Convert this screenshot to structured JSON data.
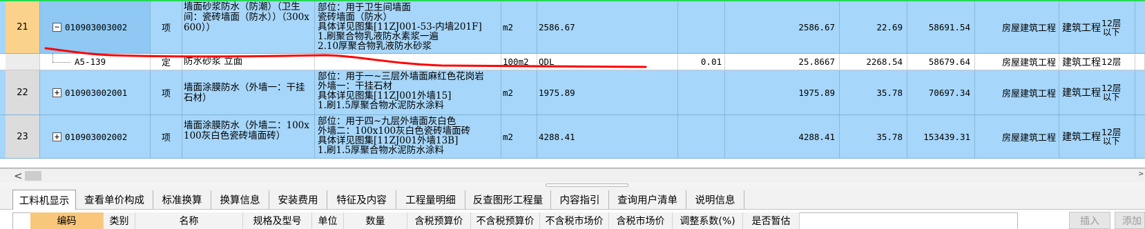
{
  "grid": {
    "rows": [
      {
        "index": "21",
        "code": "010903003002",
        "expander": "−",
        "type": "项",
        "name": "墙面砂浆防水（防潮）（卫生间：瓷砖墙面（防水））（300x600））",
        "description": "部位：用于卫生间墙面\n瓷砖墙面（防水）\n具体详见图集[11ZJ001-53-内墙201F]\n1.刷聚合物乳液防水素浆一遍\n2.10厚聚合物乳液防水砂浆",
        "unit": "m2",
        "expression": "2586.67",
        "content": "",
        "quantity": "2586.67",
        "unit_price": "22.69",
        "total": "58691.54",
        "professional": "房屋建筑工程",
        "spec_main": "建筑工程",
        "spec_small": "12层\n以下"
      },
      {
        "index": "",
        "code": "A5-139",
        "type": "定",
        "name": "防水砂浆 立面",
        "description": "",
        "unit": "100m2",
        "expression": "QDL",
        "content": "0.01",
        "quantity": "25.8667",
        "unit_price": "2268.54",
        "total": "58679.64",
        "professional": "房屋建筑工程",
        "spec_main": "建筑工程",
        "spec_small": "12层"
      },
      {
        "index": "22",
        "code": "010903002001",
        "expander": "+",
        "type": "项",
        "name": "墙面涂膜防水（外墙一：干挂石材）",
        "description": "部位：用于一~三层外墙面麻红色花岗岩\n外墙一：干挂石材\n具体详见图集[11ZJ001外墙15]\n1.刷1.5厚聚合物水泥防水涂料",
        "unit": "m2",
        "expression": "1975.89",
        "content": "",
        "quantity": "1975.89",
        "unit_price": "35.78",
        "total": "70697.34",
        "professional": "房屋建筑工程",
        "spec_main": "建筑工程",
        "spec_small": "12层\n以下"
      },
      {
        "index": "23",
        "code": "010903002002",
        "expander": "+",
        "type": "项",
        "name": "墙面涂膜防水（外墙二：100x100灰白色瓷砖墙面砖）",
        "description": "部位：用于四~九层外墙面灰白色\n外墙二：100x100灰白色瓷砖墙面砖\n具体详见图集[11ZJ001外墙13B]\n1.刷1.5厚聚合物水泥防水涂料",
        "unit": "m2",
        "expression": "4288.41",
        "content": "",
        "quantity": "4288.41",
        "unit_price": "35.78",
        "total": "153439.31",
        "professional": "房屋建筑工程",
        "spec_main": "建筑工程",
        "spec_small": "12层\n以下"
      }
    ]
  },
  "scrollbar": {
    "left_arrow": "<",
    "right_arrow": ">"
  },
  "tabs": [
    "工料机显示",
    "查看单价构成",
    "标准换算",
    "换算信息",
    "安装费用",
    "特征及内容",
    "工程量明细",
    "反查图形工程量",
    "内容指引",
    "查询用户清单",
    "说明信息"
  ],
  "lower_headers": [
    "编码",
    "类别",
    "名称",
    "规格及型号",
    "单位",
    "数量",
    "含税预算价",
    "不含税预算价",
    "不含税市场价",
    "含税市场价",
    "调整系数(%)",
    "是否暂估"
  ],
  "side_buttons": {
    "insert": "插入",
    "add": "添加"
  },
  "colors": {
    "row_blue": "#a6d6f9",
    "selected_index": "#fbd28c",
    "first_header": "#f9c77c",
    "annotation_red": "#ff0000",
    "top_border_green": "#27d957"
  }
}
